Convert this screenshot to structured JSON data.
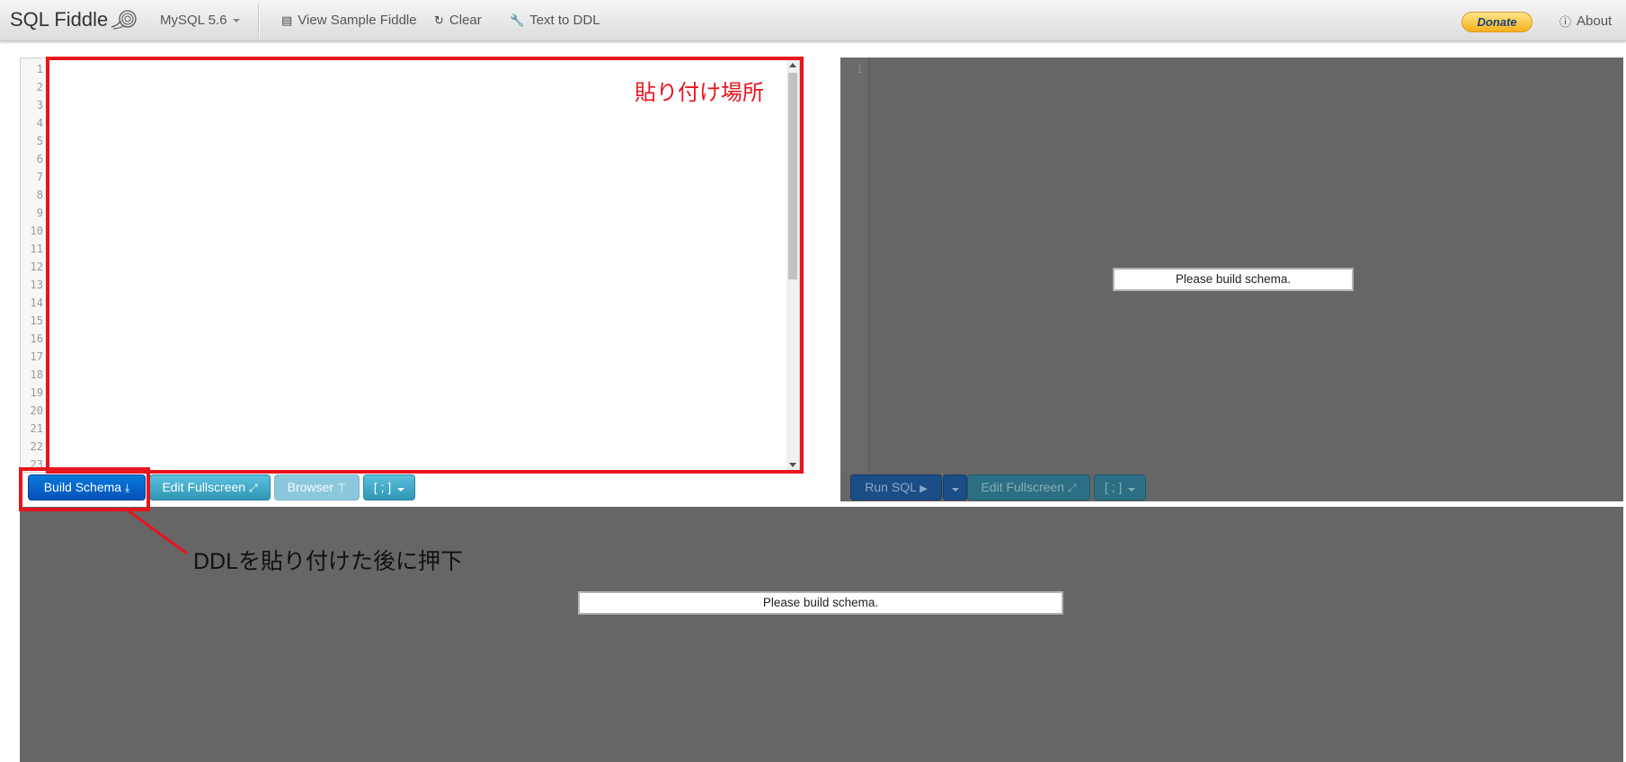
{
  "navbar": {
    "brand": "SQL Fiddle",
    "db_selector": "MySQL 5.6",
    "view_sample": "View Sample Fiddle",
    "clear": "Clear",
    "text_to_ddl": "Text to DDL",
    "donate": "Donate",
    "about": "About"
  },
  "schema_editor": {
    "line_numbers": [
      "1",
      "2",
      "3",
      "4",
      "5",
      "6",
      "7",
      "8",
      "9",
      "10",
      "11",
      "12",
      "13",
      "14",
      "15",
      "16",
      "17",
      "18",
      "19",
      "20",
      "21",
      "22",
      "23"
    ]
  },
  "schema_buttons": {
    "build_schema": "Build Schema",
    "edit_fullscreen": "Edit Fullscreen",
    "browser": "Browser",
    "delimiter": "[ ; ]"
  },
  "query_panel": {
    "line_number": "1",
    "message": "Please build schema.",
    "run_sql": "Run SQL",
    "edit_fullscreen": "Edit Fullscreen",
    "delimiter": "[ ; ]"
  },
  "results_panel": {
    "message": "Please build schema."
  },
  "annotations": {
    "paste_location": "貼り付け場所",
    "press_after_paste": "DDLを貼り付けた後に押下"
  },
  "colors": {
    "annotation_red": "#e8141e",
    "panel_gray": "#666666",
    "primary_blue": "#0453b8"
  }
}
